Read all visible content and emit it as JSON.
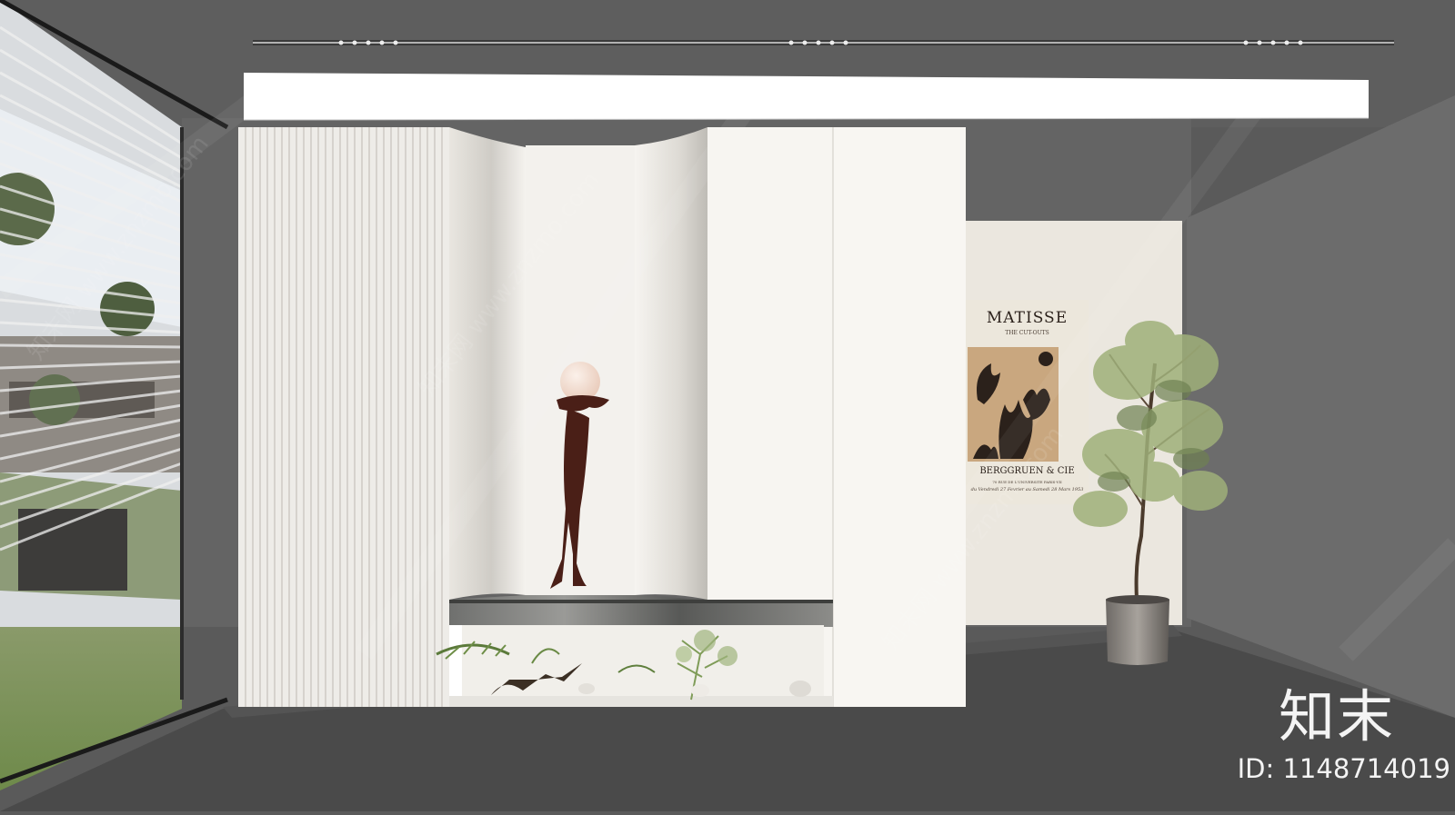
{
  "poster": {
    "title": "MATISSE",
    "subtitle": "THE CUT-OUTS",
    "gallery": "BERGGRUEN & CIE",
    "address": "70 RUE DE L'UNIVERSITE PARIS-VII",
    "dates": "du Vendredi 27 Fevrier au Samedi 28 Mars 1953"
  },
  "watermark": {
    "site": "知末网 www.znzmo.com",
    "brand": "知末",
    "id_text": "ID: 1148714019"
  },
  "colors": {
    "floor": "#4a4a4a",
    "wall": "#6a6a6a",
    "panel": "#f7f5f1",
    "poster_bg": "#ece7dc",
    "poster_art": "#c9a77f",
    "sculpture": "#4a1f17"
  }
}
